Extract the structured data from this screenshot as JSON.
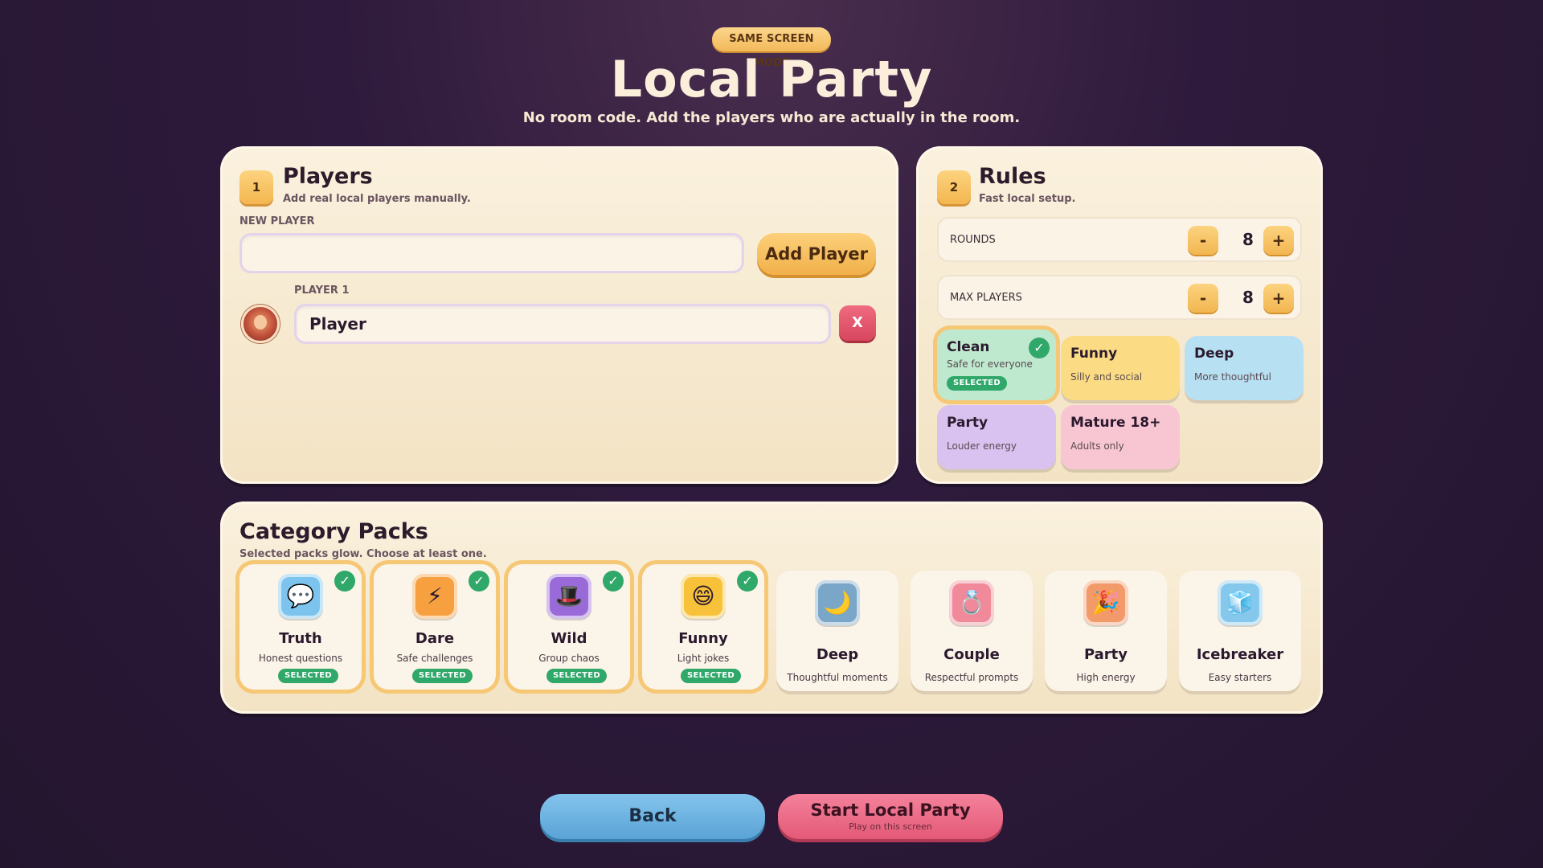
{
  "header": {
    "mode_badge": "SAME SCREEN MODE",
    "title": "Local Party",
    "subtitle": "No room code. Add the players who are actually in the room."
  },
  "players": {
    "step": "1",
    "title": "Players",
    "subtitle": "Add real local players manually.",
    "new_player_label": "NEW PLAYER",
    "new_player_value": "",
    "add_button": "Add Player",
    "list": [
      {
        "label": "PLAYER 1",
        "name": "Player",
        "remove": "X"
      }
    ]
  },
  "rules": {
    "step": "2",
    "title": "Rules",
    "subtitle": "Fast local setup.",
    "rounds": {
      "label": "ROUNDS",
      "value": "8",
      "minus": "-",
      "plus": "+"
    },
    "max_players": {
      "label": "MAX PLAYERS",
      "value": "8",
      "minus": "-",
      "plus": "+"
    },
    "tones": [
      {
        "title": "Clean",
        "desc": "Safe for everyone",
        "badge": "SELECTED",
        "selected": true,
        "color": "#bfe9cf"
      },
      {
        "title": "Funny",
        "desc": "Silly and social",
        "selected": false,
        "color": "#fbdc84"
      },
      {
        "title": "Deep",
        "desc": "More thoughtful",
        "selected": false,
        "color": "#b8e0f3"
      },
      {
        "title": "Party",
        "desc": "Louder energy",
        "selected": false,
        "color": "#d9c2f0"
      },
      {
        "title": "Mature 18+",
        "desc": "Adults only",
        "selected": false,
        "color": "#f8c6d2"
      }
    ]
  },
  "packs": {
    "title": "Category Packs",
    "subtitle": "Selected packs glow. Choose at least one.",
    "items": [
      {
        "title": "Truth",
        "desc": "Honest questions",
        "badge": "SELECTED",
        "selected": true,
        "icon": "speech-heart-icon",
        "glyph": "💬",
        "color": "#7cc4ee"
      },
      {
        "title": "Dare",
        "desc": "Safe challenges",
        "badge": "SELECTED",
        "selected": true,
        "icon": "lightning-icon",
        "glyph": "⚡",
        "color": "#f7a040"
      },
      {
        "title": "Wild",
        "desc": "Group chaos",
        "badge": "SELECTED",
        "selected": true,
        "icon": "magic-hat-icon",
        "glyph": "🎩",
        "color": "#9a6ad8"
      },
      {
        "title": "Funny",
        "desc": "Light jokes",
        "badge": "SELECTED",
        "selected": true,
        "icon": "laughing-face-icon",
        "glyph": "😄",
        "color": "#f7c23a"
      },
      {
        "title": "Deep",
        "desc": "Thoughtful moments",
        "selected": false,
        "icon": "moon-icon",
        "glyph": "🌙",
        "color": "#7aa6c8"
      },
      {
        "title": "Couple",
        "desc": "Respectful prompts",
        "selected": false,
        "icon": "rings-icon",
        "glyph": "💍",
        "color": "#f08a9a"
      },
      {
        "title": "Party",
        "desc": "High energy",
        "selected": false,
        "icon": "party-popper-icon",
        "glyph": "🎉",
        "color": "#f29a6a"
      },
      {
        "title": "Icebreaker",
        "desc": "Easy starters",
        "selected": false,
        "icon": "ice-cube-icon",
        "glyph": "🧊",
        "color": "#86c8ec"
      }
    ]
  },
  "footer": {
    "back": "Back",
    "start_title": "Start Local Party",
    "start_sub": "Play on this screen"
  }
}
